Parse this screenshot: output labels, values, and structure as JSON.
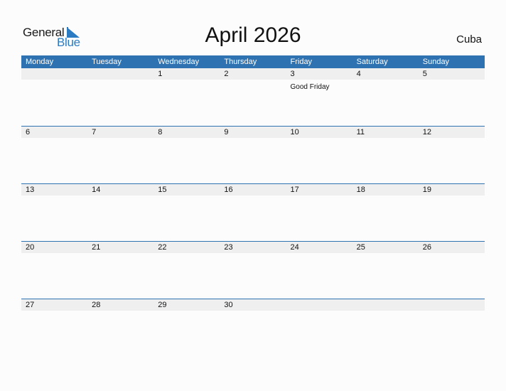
{
  "logo": {
    "word1": "General",
    "word2": "Blue"
  },
  "title": "April 2026",
  "country": "Cuba",
  "colors": {
    "accent": "#2e72b2",
    "date_strip": "#efefef",
    "logo_blue": "#2a7bc1"
  },
  "weekdays": [
    "Monday",
    "Tuesday",
    "Wednesday",
    "Thursday",
    "Friday",
    "Saturday",
    "Sunday"
  ],
  "weeks": [
    {
      "days": [
        "",
        "",
        "1",
        "2",
        "3",
        "4",
        "5"
      ],
      "events": [
        "",
        "",
        "",
        "",
        "Good Friday",
        "",
        ""
      ]
    },
    {
      "days": [
        "6",
        "7",
        "8",
        "9",
        "10",
        "11",
        "12"
      ],
      "events": [
        "",
        "",
        "",
        "",
        "",
        "",
        ""
      ]
    },
    {
      "days": [
        "13",
        "14",
        "15",
        "16",
        "17",
        "18",
        "19"
      ],
      "events": [
        "",
        "",
        "",
        "",
        "",
        "",
        ""
      ]
    },
    {
      "days": [
        "20",
        "21",
        "22",
        "23",
        "24",
        "25",
        "26"
      ],
      "events": [
        "",
        "",
        "",
        "",
        "",
        "",
        ""
      ]
    },
    {
      "days": [
        "27",
        "28",
        "29",
        "30",
        "",
        "",
        ""
      ],
      "events": [
        "",
        "",
        "",
        "",
        "",
        "",
        ""
      ]
    }
  ]
}
